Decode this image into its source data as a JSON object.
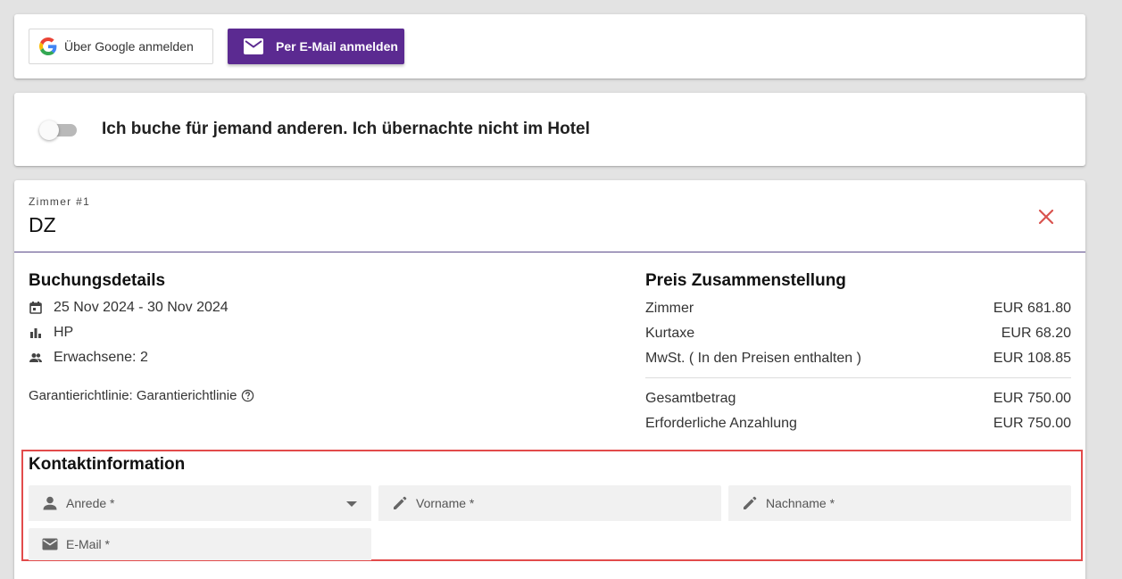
{
  "login": {
    "google_label": "Über Google anmelden",
    "email_label": "Per E-Mail anmelden"
  },
  "booking_toggle": {
    "label": "Ich buche für jemand anderen. Ich übernachte nicht im Hotel",
    "checked": false
  },
  "room": {
    "kicker": "Zimmer #1",
    "title": "DZ",
    "booking_details": {
      "heading": "Buchungsdetails",
      "dates": "25 Nov 2024 - 30 Nov 2024",
      "board": "HP",
      "guests": "Erwachsene: 2",
      "guarantee": "Garantierichtlinie: Garantierichtlinie"
    },
    "price": {
      "heading": "Preis Zusammenstellung",
      "rows": [
        {
          "label": "Zimmer",
          "value": "EUR 681.80"
        },
        {
          "label": "Kurtaxe",
          "value": "EUR 68.20"
        },
        {
          "label": "MwSt. ( In den Preisen enthalten )",
          "value": "EUR 108.85"
        }
      ],
      "totals": [
        {
          "label": "Gesamtbetrag",
          "value": "EUR 750.00"
        },
        {
          "label": "Erforderliche Anzahlung",
          "value": "EUR 750.00"
        }
      ]
    },
    "contact": {
      "heading": "Kontaktinformation",
      "salutation_placeholder": "Anrede *",
      "firstname_placeholder": "Vorname *",
      "lastname_placeholder": "Nachname *",
      "email_placeholder": "E-Mail *"
    }
  },
  "colors": {
    "primary": "#5b2a91",
    "highlight_border": "#e24b4b",
    "close_icon": "#d9534f"
  },
  "icons": [
    "google-icon",
    "mail-icon",
    "calendar-icon",
    "bar-chart-icon",
    "people-icon",
    "help-circle-icon",
    "close-icon",
    "person-icon",
    "pencil-icon",
    "chevron-down-icon"
  ]
}
